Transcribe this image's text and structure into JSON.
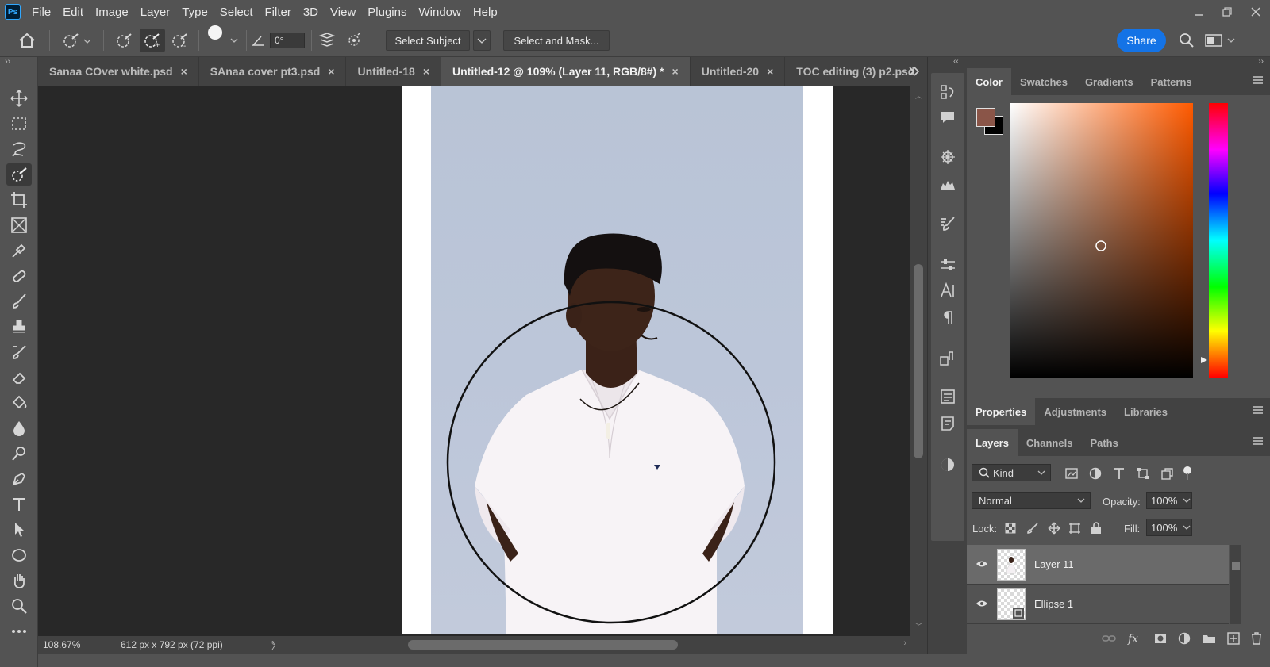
{
  "app": {
    "logo": "Ps"
  },
  "menu": [
    "File",
    "Edit",
    "Image",
    "Layer",
    "Type",
    "Select",
    "Filter",
    "3D",
    "View",
    "Plugins",
    "Window",
    "Help"
  ],
  "window_controls": [
    "minimize-icon",
    "restore-icon",
    "close-icon"
  ],
  "options": {
    "brush_size": "30",
    "angle": "0°",
    "select_subject_label": "Select Subject",
    "select_and_mask_label": "Select and Mask...",
    "share_label": "Share"
  },
  "tabs": [
    {
      "label": "Sanaa COver white.psd",
      "close": "×"
    },
    {
      "label": "SAnaa cover pt3.psd",
      "close": "×"
    },
    {
      "label": "Untitled-18",
      "close": "×"
    },
    {
      "label": "Untitled-12 @ 109% (Layer 11, RGB/8#) *",
      "close": "×",
      "active": true
    },
    {
      "label": "Untitled-20",
      "close": "×"
    },
    {
      "label": "TOC editing (3) p2.psd",
      "close": ""
    }
  ],
  "status": {
    "zoom": "108.67%",
    "doc_info": "612 px x 792 px (72 ppi)",
    "arrow": "〉"
  },
  "colors": {
    "foreground": "#8a5548",
    "background": "#000000",
    "accent": "#1473e6"
  },
  "color_panel_tabs": [
    "Color",
    "Swatches",
    "Gradients",
    "Patterns"
  ],
  "properties_tabs": [
    "Properties",
    "Adjustments",
    "Libraries"
  ],
  "layers_tabs": [
    "Layers",
    "Channels",
    "Paths"
  ],
  "layers": {
    "filter_kind": "Kind",
    "blend_mode": "Normal",
    "opacity_label": "Opacity:",
    "opacity_value": "100%",
    "lock_label": "Lock:",
    "fill_label": "Fill:",
    "fill_value": "100%",
    "items": [
      {
        "name": "Layer 11",
        "selected": true
      },
      {
        "name": "Ellipse 1",
        "selected": false
      }
    ]
  }
}
